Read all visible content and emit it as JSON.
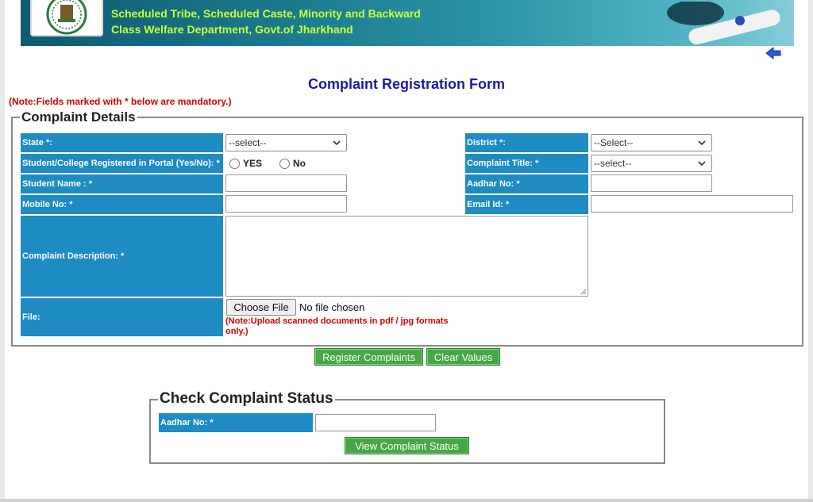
{
  "header": {
    "line1": "Scheduled Tribe, Scheduled Caste, Minority and Backward",
    "line2": "Class Welfare Department, Govt.of Jharkhand"
  },
  "form_title": "Complaint Registration Form",
  "note": "(Note:Fields marked with * below are mandatory.)",
  "complaint_details": {
    "legend": "Complaint Details",
    "state_label": "State *:",
    "state_value": "--select--",
    "district_label": "District *:",
    "district_value": "--Select--",
    "registered_label": "Student/College Registered in Portal (Yes/No): *",
    "yes_label": "YES",
    "no_label": "No",
    "complaint_title_label": "Complaint Title: *",
    "complaint_title_value": "--select--",
    "student_name_label": "Student Name : *",
    "aadhar_label": "Aadhar No: *",
    "mobile_label": "Mobile No: *",
    "email_label": "Email Id: *",
    "description_label": "Complaint Description: *",
    "file_label": "File:",
    "choose_file": "Choose File",
    "no_file": "No file chosen",
    "file_note": "(Note:Upload scanned documents in pdf / jpg formats only.)"
  },
  "actions": {
    "register": "Register Complaints",
    "clear": "Clear Values"
  },
  "status_check": {
    "legend": "Check Complaint Status",
    "aadhar_label": "Aadhar No: *",
    "view_button": "View  Complaint Status"
  },
  "colors": {
    "label_bg": "#1e8bc3",
    "title_blue": "#1a1aa6",
    "note_red": "#d40000",
    "button_green": "#45a845",
    "header_text": "#c8ff3a"
  }
}
